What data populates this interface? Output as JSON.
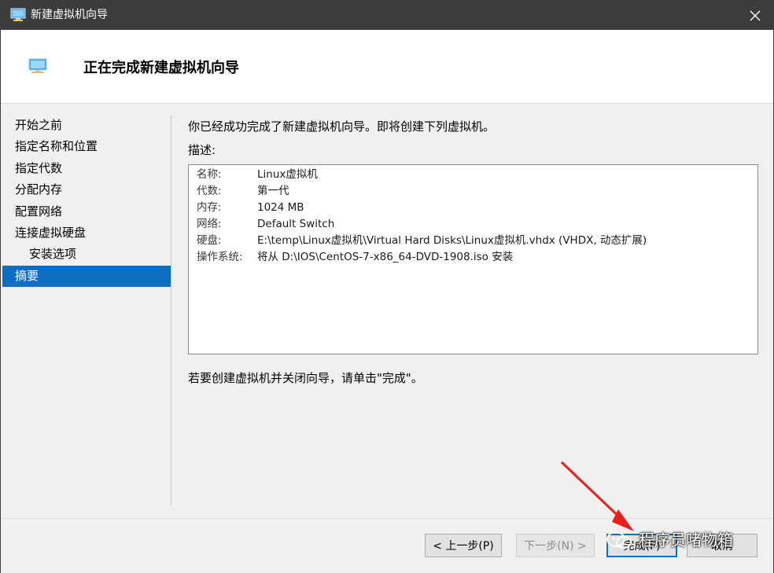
{
  "window": {
    "title": "新建虚拟机向导",
    "close_glyph": "✕"
  },
  "header": {
    "heading": "正在完成新建虚拟机向导"
  },
  "nav": {
    "items": [
      {
        "label": "开始之前",
        "selected": false,
        "sub": false
      },
      {
        "label": "指定名称和位置",
        "selected": false,
        "sub": false
      },
      {
        "label": "指定代数",
        "selected": false,
        "sub": false
      },
      {
        "label": "分配内存",
        "selected": false,
        "sub": false
      },
      {
        "label": "配置网络",
        "selected": false,
        "sub": false
      },
      {
        "label": "连接虚拟硬盘",
        "selected": false,
        "sub": false
      },
      {
        "label": "安装选项",
        "selected": false,
        "sub": true
      },
      {
        "label": "摘要",
        "selected": true,
        "sub": false
      }
    ]
  },
  "content": {
    "intro": "你已经成功完成了新建虚拟机向导。即将创建下列虚拟机。",
    "desc_label": "描述:",
    "summary": [
      {
        "key": "名称:",
        "value": "Linux虚拟机"
      },
      {
        "key": "代数:",
        "value": "第一代"
      },
      {
        "key": "内存:",
        "value": "1024 MB"
      },
      {
        "key": "网络:",
        "value": "Default Switch"
      },
      {
        "key": "硬盘:",
        "value": "E:\\temp\\Linux虚拟机\\Virtual Hard Disks\\Linux虚拟机.vhdx (VHDX, 动态扩展)"
      },
      {
        "key": "操作系统:",
        "value": "将从 D:\\IOS\\CentOS-7-x86_64-DVD-1908.iso 安装"
      }
    ],
    "finish_note": "若要创建虚拟机并关闭向导，请单击\"完成\"。"
  },
  "footer": {
    "prev_label": "< 上一步(P)",
    "next_label": "下一步(N) >",
    "finish_label": "完成(F)",
    "cancel_label": "取消"
  },
  "watermark": {
    "text": "程序员啫物箱"
  },
  "colors": {
    "titlebar": "#3c3c3c",
    "selection": "#0e6fc2",
    "arrow": "#e8201a"
  }
}
